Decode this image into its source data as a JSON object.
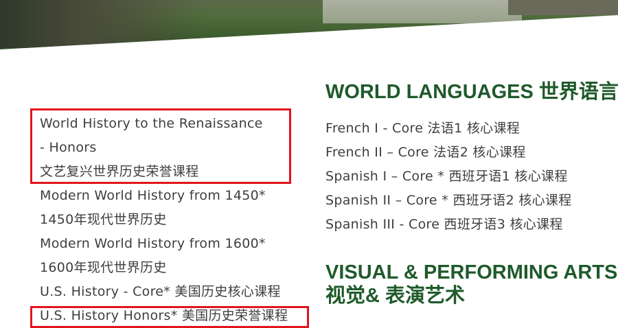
{
  "left_list": [
    "World History to the Renaissance",
    "- Honors",
    "文艺复兴世界历史荣誉课程",
    "Modern World History from 1450*",
    "1450年现代世界历史",
    "Modern World History from 1600*",
    "1600年现代世界历史",
    "U.S. History - Core* 美国历史核心课程",
    "U.S. History Honors* 美国历史荣誉课程"
  ],
  "world_languages": {
    "heading": "WORLD LANGUAGES 世界语言",
    "items": [
      "French I - Core 法语1 核心课程",
      "French II – Core 法语2 核心课程",
      "Spanish I – Core * 西班牙语1 核心课程",
      "Spanish II – Core * 西班牙语2 核心课程",
      "Spanish III - Core 西班牙语3 核心课程"
    ]
  },
  "visual_performing_arts": {
    "heading_line1": "VISUAL & PERFORMING ARTS",
    "heading_line2": "视觉& 表演艺术"
  },
  "highlight_color": "#e1141e",
  "heading_color": "#1f5a2b"
}
